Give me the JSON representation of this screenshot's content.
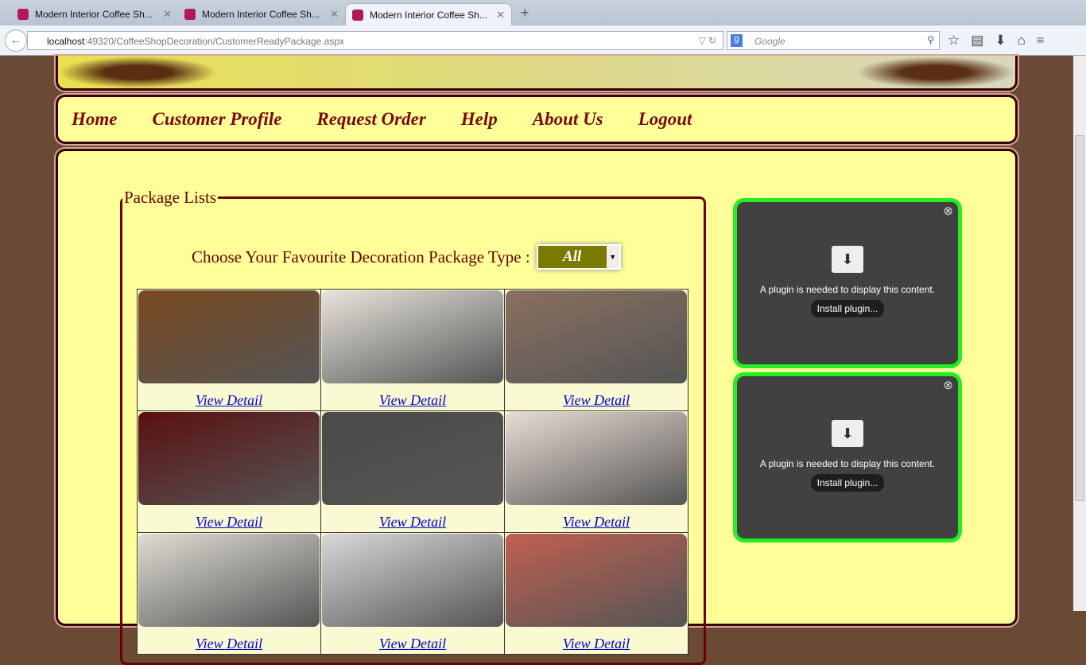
{
  "browser": {
    "tabs": [
      "Modern Interior Coffee Sh...",
      "Modern Interior Coffee Sh...",
      "Modern Interior Coffee Sh..."
    ],
    "url_host": "localhost",
    "url_rest": ":49320/CoffeeShopDecoration/CustomerReadyPackage.aspx",
    "search_placeholder": "Google"
  },
  "menu": [
    "Home",
    "Customer Profile",
    "Request Order",
    "Help",
    "About Us",
    "Logout"
  ],
  "packages": {
    "legend": "Package Lists",
    "choose_label": "Choose Your Favourite Decoration Package Type :",
    "selected_type": "All",
    "link_label": "View Detail",
    "images": [
      "#7a4a20",
      "#e8e4dc",
      "#8a7060",
      "#5a1010",
      "#4a4a48",
      "#e8dcd4",
      "#e0dcd4",
      "#d8d8d8",
      "#c06050"
    ]
  },
  "plugin": {
    "message": "A plugin is needed to display this content.",
    "button": "Install plugin..."
  }
}
